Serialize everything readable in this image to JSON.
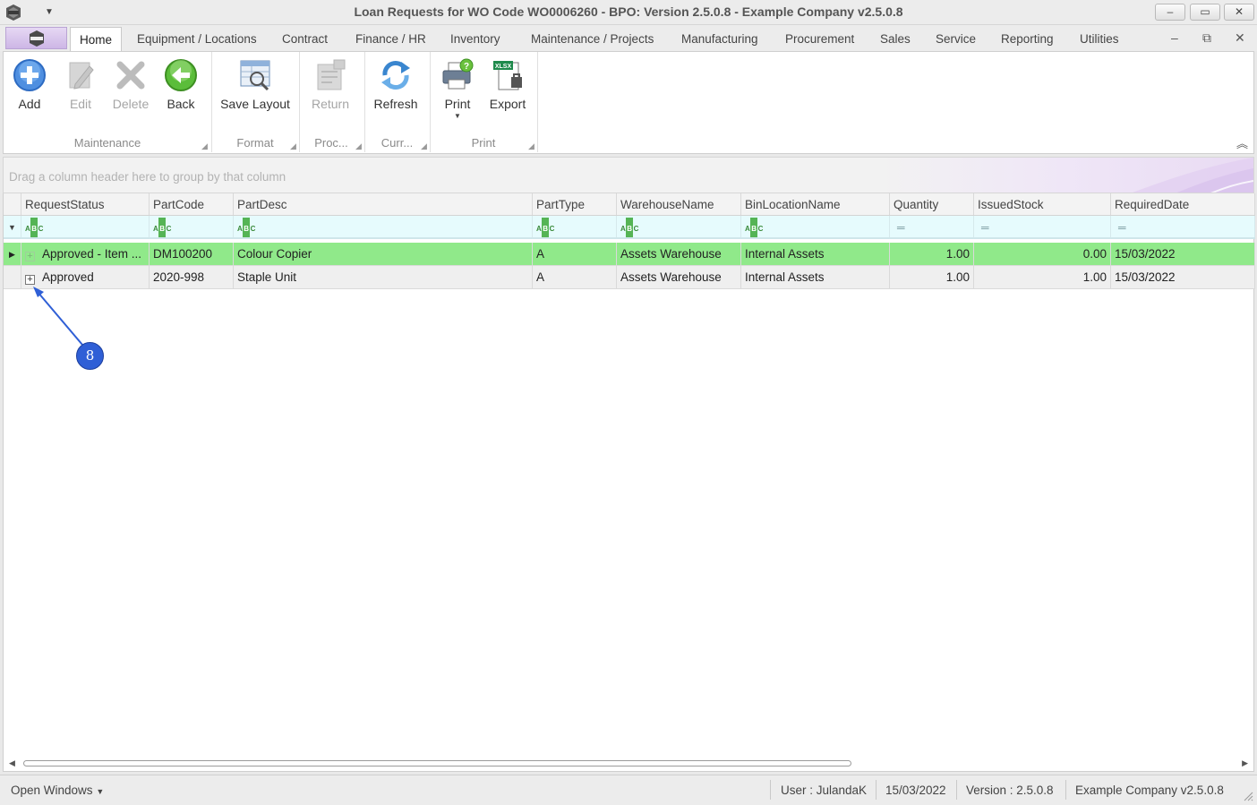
{
  "window": {
    "title": "Loan Requests for WO Code WO0006260 - BPO: Version 2.5.0.8 - Example Company v2.5.0.8",
    "minimize_glyph": "–",
    "maximize_glyph": "▭",
    "close_glyph": "✕"
  },
  "menu": {
    "tabs": [
      {
        "label": "Home"
      },
      {
        "label": "Equipment / Locations"
      },
      {
        "label": "Contract"
      },
      {
        "label": "Finance / HR"
      },
      {
        "label": "Inventory"
      },
      {
        "label": "Maintenance / Projects"
      },
      {
        "label": "Manufacturing"
      },
      {
        "label": "Procurement"
      },
      {
        "label": "Sales"
      },
      {
        "label": "Service"
      },
      {
        "label": "Reporting"
      },
      {
        "label": "Utilities"
      }
    ],
    "active_tab": "Home"
  },
  "ribbon": {
    "buttons": {
      "add": "Add",
      "edit": "Edit",
      "delete": "Delete",
      "back": "Back",
      "save_layout": "Save Layout",
      "return": "Return",
      "refresh": "Refresh",
      "print": "Print",
      "export": "Export"
    },
    "groups": {
      "maintenance": "Maintenance",
      "format": "Format",
      "process": "Proc...",
      "currency": "Curr...",
      "print": "Print"
    },
    "icons": {
      "add": "add-circle-icon",
      "edit": "edit-pencil-icon",
      "delete": "delete-x-icon",
      "back": "back-arrow-icon",
      "save_layout": "save-layout-icon",
      "return": "return-icon",
      "refresh": "refresh-icon",
      "print": "printer-icon",
      "export": "export-xlsx-icon"
    },
    "export_badge": "XLSX"
  },
  "grid": {
    "group_panel_hint": "Drag a column header here to group by that column",
    "columns": [
      "RequestStatus",
      "PartCode",
      "PartDesc",
      "PartType",
      "WarehouseName",
      "BinLocationName",
      "Quantity",
      "IssuedStock",
      "RequiredDate"
    ],
    "rows": [
      {
        "RequestStatus": "Approved - Item ...",
        "PartCode": "DM100200",
        "PartDesc": "Colour Copier",
        "PartType": "A",
        "WarehouseName": "Assets Warehouse",
        "BinLocationName": "Internal Assets",
        "Quantity": "1.00",
        "IssuedStock": "0.00",
        "RequiredDate": "15/03/2022",
        "selected": true
      },
      {
        "RequestStatus": "Approved",
        "PartCode": "2020-998",
        "PartDesc": "Staple Unit",
        "PartType": "A",
        "WarehouseName": "Assets Warehouse",
        "BinLocationName": "Internal Assets",
        "Quantity": "1.00",
        "IssuedStock": "1.00",
        "RequiredDate": "15/03/2022",
        "selected": false
      }
    ],
    "selected_row_color": "#90e98a",
    "filter_row_color": "#e6fbfd"
  },
  "annotation": {
    "callout_number": "8",
    "color": "#2f5fd6"
  },
  "statusbar": {
    "open_windows": "Open Windows",
    "user": "User : JulandaK",
    "date": "15/03/2022",
    "version": "Version : 2.5.0.8",
    "company": "Example Company v2.5.0.8"
  }
}
